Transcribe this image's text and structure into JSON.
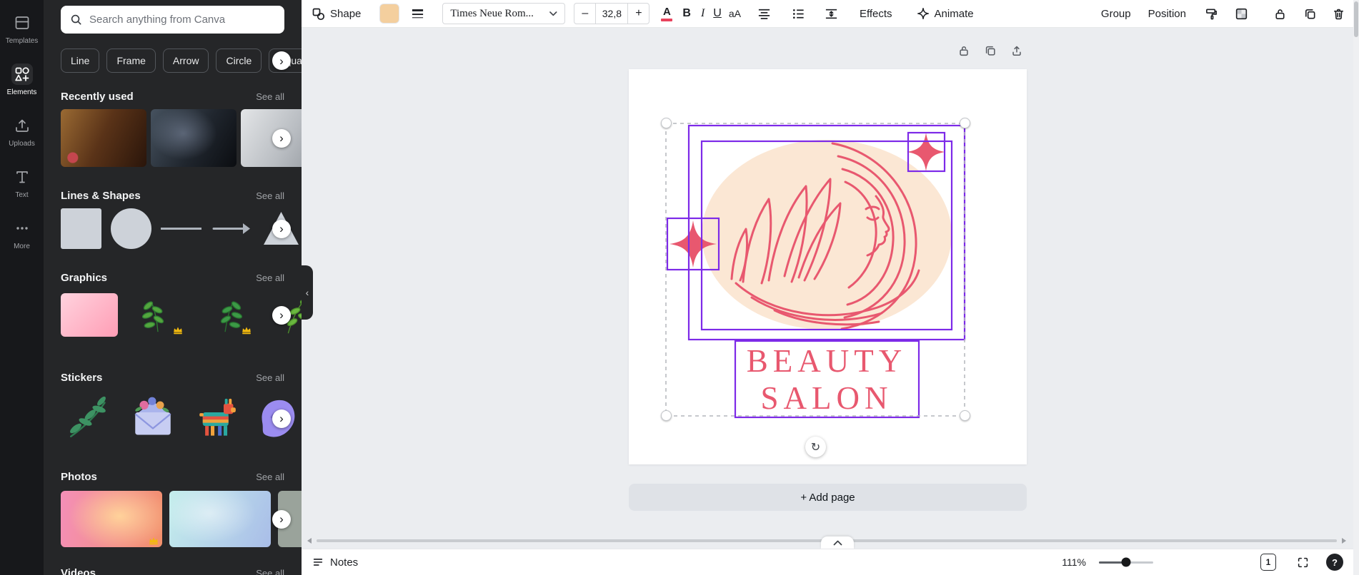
{
  "rail": {
    "items": [
      {
        "label": "Templates"
      },
      {
        "label": "Elements"
      },
      {
        "label": "Uploads"
      },
      {
        "label": "Text"
      },
      {
        "label": "More"
      }
    ]
  },
  "panel": {
    "search_placeholder": "Search anything from Canva",
    "chips": [
      {
        "label": "Line"
      },
      {
        "label": "Frame"
      },
      {
        "label": "Arrow"
      },
      {
        "label": "Circle"
      },
      {
        "label": "Square"
      }
    ],
    "sections": {
      "recently_used": {
        "title": "Recently used",
        "action": "See all"
      },
      "lines_shapes": {
        "title": "Lines & Shapes",
        "action": "See all"
      },
      "graphics": {
        "title": "Graphics",
        "action": "See all"
      },
      "stickers": {
        "title": "Stickers",
        "action": "See all"
      },
      "photos": {
        "title": "Photos",
        "action": "See all"
      },
      "videos": {
        "title": "Videos",
        "action": "See all"
      }
    }
  },
  "toolbar": {
    "shape_label": "Shape",
    "font_name": "Times Neue Rom...",
    "font_size": "32,8",
    "minus_label": "–",
    "plus_label": "+",
    "text_color_label": "A",
    "bold_label": "B",
    "italic_label": "I",
    "underline_label": "U",
    "case_label": "aA",
    "effects_label": "Effects",
    "animate_label": "Animate",
    "group_label": "Group",
    "position_label": "Position"
  },
  "design": {
    "title_line1": "BEAUTY",
    "title_line2": "SALON",
    "colors": {
      "pink": "#e8586f",
      "peach": "#fbe7d4",
      "selection_purple": "#7d2ae8",
      "fill_swatch": "#f4cf9e"
    }
  },
  "canvas": {
    "add_page_label": "+ Add page"
  },
  "statusbar": {
    "notes_label": "Notes",
    "zoom_level": "111%",
    "page_number": "1",
    "help_label": "?"
  },
  "icons": {
    "chevron_right": "›",
    "collapse_panel": "‹",
    "rotate": "↻"
  }
}
